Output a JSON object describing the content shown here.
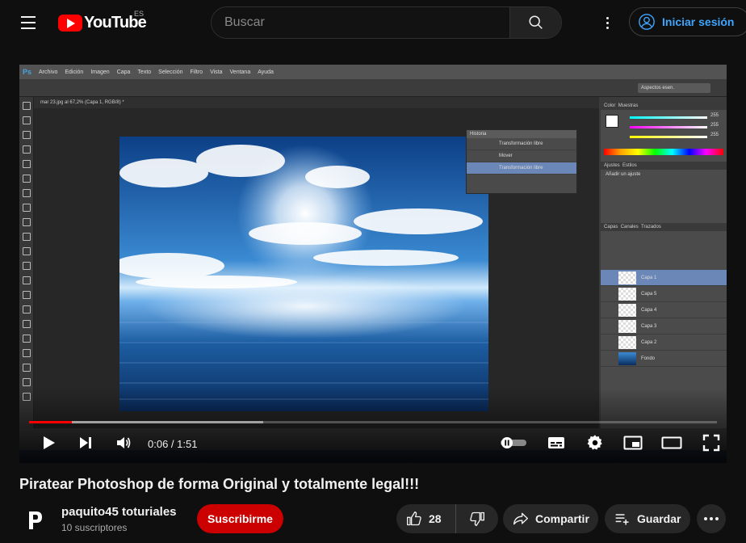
{
  "header": {
    "logo_text": "YouTube",
    "country_code": "ES",
    "search_placeholder": "Buscar",
    "signin_label": "Iniciar sesión"
  },
  "player": {
    "time_display": "0:06 / 1:51",
    "progress_played": 0.062,
    "progress_buffered": 0.34,
    "photoshop": {
      "logo": "Ps",
      "menu": [
        "Archivo",
        "Edición",
        "Imagen",
        "Capa",
        "Texto",
        "Selección",
        "Filtro",
        "Vista",
        "Ventana",
        "Ayuda"
      ],
      "doc_tab": "mar 23.jpg al 67,2% (Capa 1, RGB/8) *",
      "workspace": "Aspectos esen.",
      "history_title": "Historia",
      "history_items": [
        "Transformación libre",
        "Mover",
        "Transformación libre"
      ],
      "panel_tabs": [
        "Color",
        "Muestras"
      ],
      "adjust_tabs": [
        "Ajustes",
        "Estilos"
      ],
      "adjust_hint": "Añadir un ajuste",
      "layers_tabs": [
        "Capas",
        "Canales",
        "Trazados"
      ],
      "rgb_values": [
        "255",
        "255",
        "255"
      ],
      "layers": [
        "Capa 1",
        "Capa 5",
        "Capa 4",
        "Capa 3",
        "Capa 2",
        "Fondo"
      ]
    }
  },
  "video": {
    "title": "Piratear Photoshop de forma Original y totalmente legal!!!",
    "channel_name": "paquito45 toturiales",
    "subscribers": "10 suscriptores",
    "subscribe_label": "Suscribirme",
    "like_count": "28",
    "share_label": "Compartir",
    "save_label": "Guardar"
  },
  "colors": {
    "brand_red": "#ff0000",
    "subscribe_red": "#cc0000",
    "link_blue": "#3ea6ff",
    "background": "#0f0f0f",
    "pill_bg": "#272727"
  }
}
